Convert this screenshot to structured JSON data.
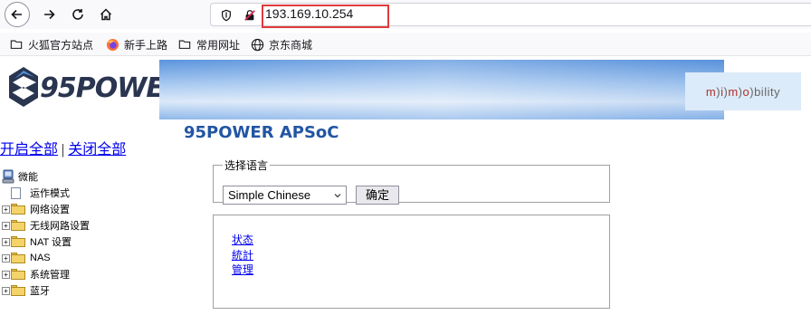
{
  "browser": {
    "url": "193.169.10.254",
    "bookmarks": [
      {
        "label": "火狐官方站点",
        "icon": "folder-icon"
      },
      {
        "label": "新手上路",
        "icon": "firefox-icon"
      },
      {
        "label": "常用网址",
        "icon": "folder-icon"
      },
      {
        "label": "京东商城",
        "icon": "globe-icon"
      }
    ],
    "highlight_color": "#e03b3b"
  },
  "header": {
    "logo_text": "95POWER",
    "banner_logo": {
      "m1": "m",
      "i": "i",
      "m2": "m",
      "o": "o",
      "bility": "bility"
    }
  },
  "sidebar": {
    "expand_all": "开启全部",
    "separator": "|",
    "collapse_all": "关闭全部",
    "root_label": "微能",
    "items": [
      {
        "label": "运作模式",
        "type": "page"
      },
      {
        "label": "网络设置",
        "type": "folder"
      },
      {
        "label": "无线网路设置",
        "type": "folder"
      },
      {
        "label": "NAT 设置",
        "type": "folder"
      },
      {
        "label": "NAS",
        "type": "folder"
      },
      {
        "label": "系统管理",
        "type": "folder"
      },
      {
        "label": "蓝牙",
        "type": "folder"
      }
    ]
  },
  "main": {
    "title": "95POWER APSoC",
    "language": {
      "legend": "选择语言",
      "selected": "Simple Chinese",
      "confirm": "确定"
    },
    "links": [
      "状态",
      "統計",
      "管理"
    ]
  },
  "colors": {
    "title_blue": "#2255a4",
    "link_blue": "#0000ee"
  }
}
